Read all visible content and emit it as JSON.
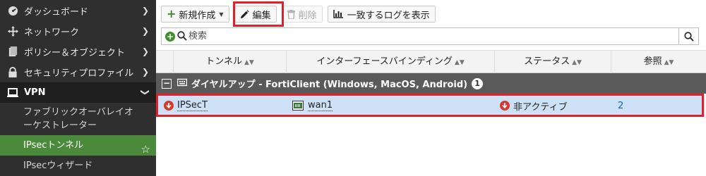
{
  "sidebar": {
    "items": [
      {
        "label": "ダッシュボード",
        "icon": "dashboard-icon"
      },
      {
        "label": "ネットワーク",
        "icon": "network-move-icon"
      },
      {
        "label": "ポリシー＆オブジェクト",
        "icon": "policy-icon"
      },
      {
        "label": "セキュリティプロファイル",
        "icon": "lock-icon"
      },
      {
        "label": "VPN",
        "icon": "laptop-icon"
      }
    ],
    "sub_items": {
      "fabric": "ファブリックオーバレイオーケストレーター",
      "ipsec_tunnel": "IPsecトンネル",
      "ipsec_wizard": "IPsecウィザード"
    }
  },
  "toolbar": {
    "new_label": "新規作成",
    "edit_label": "編集",
    "delete_label": "削除",
    "log_label": "一致するログを表示"
  },
  "search": {
    "placeholder": "検索"
  },
  "table": {
    "columns": [
      "トンネル",
      "インターフェースバインディング",
      "ステータス",
      "参照"
    ],
    "group": {
      "label": "ダイヤルアップ - FortiClient (Windows, MacOS, Android)",
      "count": "1"
    },
    "rows": [
      {
        "tunnel": "IPSecT",
        "interface": "wan1",
        "status": "非アクティブ",
        "ref": "2"
      }
    ]
  },
  "colors": {
    "sidebar_bg": "#2f2f2f",
    "active_green": "#4a8a3a",
    "highlight_red": "#e0202b",
    "selected_row": "#cfe1f6",
    "group_bg": "#5a5a5a"
  }
}
